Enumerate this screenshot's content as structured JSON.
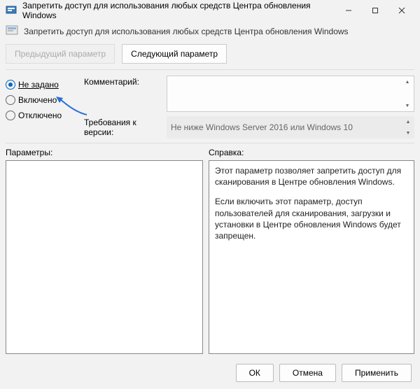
{
  "window": {
    "title": "Запретить доступ для использования любых средств Центра обновления Windows",
    "subtitle": "Запретить доступ для использования любых средств Центра обновления Windows"
  },
  "nav": {
    "prev": "Предыдущий параметр",
    "next": "Следующий параметр"
  },
  "radios": {
    "not_configured": "Не задано",
    "enabled": "Включено",
    "disabled": "Отключено"
  },
  "fields": {
    "comment_label": "Комментарий:",
    "comment_value": "",
    "requirements_label": "Требования к версии:",
    "requirements_value": "Не ниже Windows Server 2016 или Windows 10"
  },
  "panels": {
    "options_label": "Параметры:",
    "help_label": "Справка:",
    "help_p1": "Этот параметр позволяет запретить доступ для сканирования в Центре обновления Windows.",
    "help_p2": "Если включить этот параметр, доступ пользователей для сканирования, загрузки и установки в Центре обновления Windows будет запрещен."
  },
  "buttons": {
    "ok": "ОК",
    "cancel": "Отмена",
    "apply": "Применить"
  }
}
